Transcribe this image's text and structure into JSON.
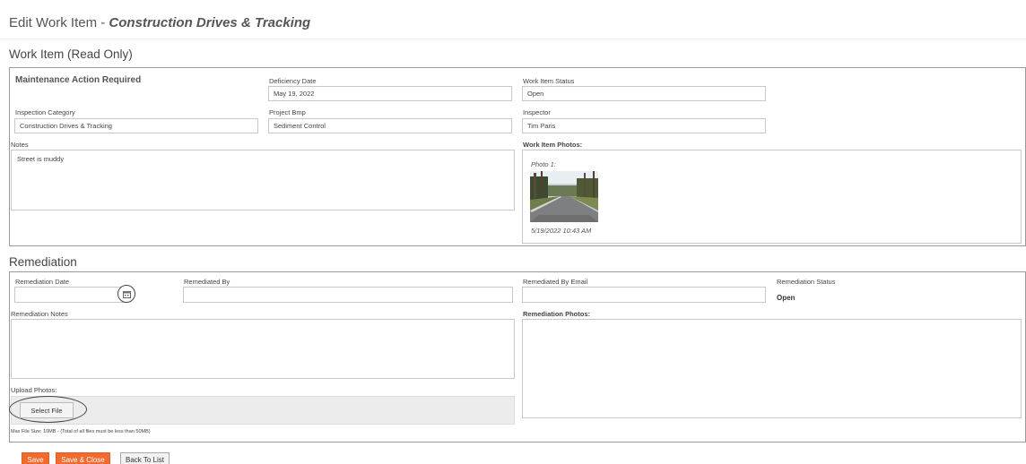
{
  "page": {
    "title_prefix": "Edit Work Item - ",
    "title_item": "Construction Drives & Tracking"
  },
  "work_item": {
    "section_title": "Work Item (Read Only)",
    "heading": "Maintenance Action Required",
    "deficiency_date": {
      "label": "Deficiency Date",
      "value": "May 19, 2022"
    },
    "status": {
      "label": "Work Item Status",
      "value": "Open"
    },
    "inspection_category": {
      "label": "Inspection Category",
      "value": "Construction Drives & Tracking"
    },
    "project_bmp": {
      "label": "Project Bmp",
      "value": "Sediment Control"
    },
    "inspector": {
      "label": "Inspector",
      "value": "Tim Paris"
    },
    "notes": {
      "label": "Notes",
      "value": "Street is muddy"
    },
    "photos": {
      "label": "Work Item Photos:",
      "items": [
        {
          "caption": "Photo 1:",
          "timestamp": "5/19/2022 10:43 AM"
        }
      ]
    }
  },
  "remediation": {
    "section_title": "Remediation",
    "date": {
      "label": "Remediation Date",
      "value": "",
      "icon": "calendar-icon"
    },
    "by": {
      "label": "Remediated By",
      "value": ""
    },
    "by_email": {
      "label": "Remediated By Email",
      "value": ""
    },
    "status": {
      "label": "Remediation Status",
      "value": "Open"
    },
    "notes": {
      "label": "Remediation Notes",
      "value": ""
    },
    "photos": {
      "label": "Remediation Photos:"
    },
    "upload": {
      "label": "Upload Photos:",
      "button": "Select File",
      "hint": "Max File Size: 10MB - (Total of all files must be less than 50MB)"
    }
  },
  "actions": {
    "save": "Save",
    "save_close": "Save & Close",
    "back": "Back To List"
  },
  "colors": {
    "accent": "#f26a2e",
    "border": "#9a9a9a"
  }
}
